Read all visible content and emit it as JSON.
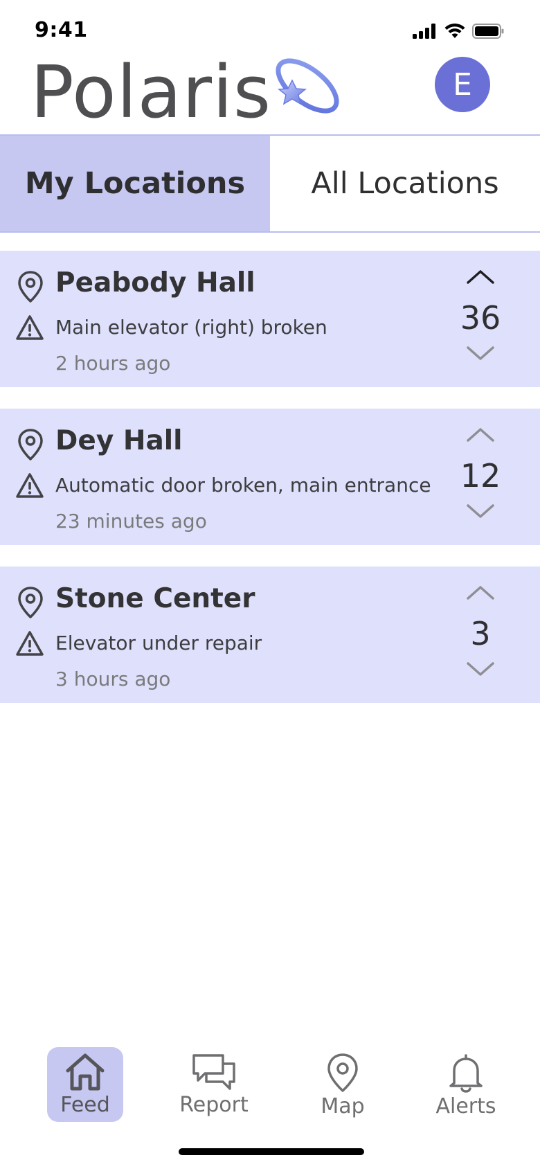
{
  "status_bar": {
    "time": "9:41",
    "icons": [
      "cellular-signal-icon",
      "wifi-icon",
      "battery-icon"
    ]
  },
  "header": {
    "app_name": "Polaris",
    "logo_icon": "star-orbit-logo-icon",
    "avatar_initial": "E"
  },
  "tabs": [
    {
      "label": "My Locations",
      "active": true
    },
    {
      "label": "All Locations",
      "active": false
    }
  ],
  "feed": [
    {
      "location": "Peabody Hall",
      "issue": "Main elevator (right) broken",
      "time": "2 hours ago",
      "votes": "36",
      "upvoted": true
    },
    {
      "location": "Dey Hall",
      "issue": "Automatic door broken, main entrance",
      "time": "23 minutes ago",
      "votes": "12",
      "upvoted": false
    },
    {
      "location": "Stone Center",
      "issue": "Elevator under repair",
      "time": "3 hours ago",
      "votes": "3",
      "upvoted": false
    }
  ],
  "bottom_nav": [
    {
      "label": "Feed",
      "icon": "home-icon",
      "active": true
    },
    {
      "label": "Report",
      "icon": "chat-bubbles-icon",
      "active": false
    },
    {
      "label": "Map",
      "icon": "map-pin-icon",
      "active": false
    },
    {
      "label": "Alerts",
      "icon": "bell-icon",
      "active": false
    }
  ],
  "colors": {
    "accent": "#6b70d6",
    "tab_active_bg": "#c6c8f1",
    "card_bg": "#dfe1fc",
    "text_primary": "#333336",
    "text_secondary": "#7a7a7d"
  }
}
